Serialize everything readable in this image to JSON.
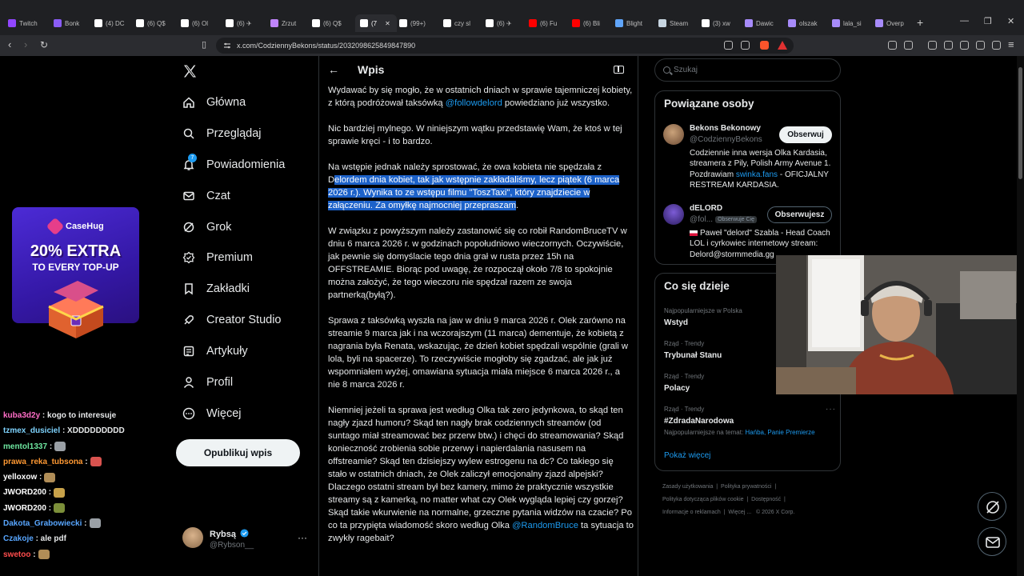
{
  "browser": {
    "tabs": [
      {
        "label": "Twitch",
        "color": "#9146ff",
        "icon": "twitch-icon"
      },
      {
        "label": "Bonk",
        "color": "#8a5cf6",
        "icon": "page-icon"
      },
      {
        "label": "(4) DC",
        "color": "#ffffff",
        "icon": "x-icon"
      },
      {
        "label": "(6) Q$",
        "color": "#ffffff",
        "icon": "x-icon"
      },
      {
        "label": "(6) Ol",
        "color": "#ffffff",
        "icon": "x-icon"
      },
      {
        "label": "(6) ✈",
        "color": "#ffffff",
        "icon": "x-icon"
      },
      {
        "label": "Zrzut",
        "color": "#c084fc",
        "icon": "pen-icon"
      },
      {
        "label": "(6) Q$",
        "color": "#ffffff",
        "icon": "x-icon"
      },
      {
        "label": "(7",
        "color": "#ffffff",
        "icon": "x-icon"
      },
      {
        "label": "(99+)",
        "color": "#ffffff",
        "icon": "tiktok-icon"
      },
      {
        "label": "czy sl",
        "color": "#ffffff",
        "icon": "google-icon"
      },
      {
        "label": "(6) ✈",
        "color": "#ffffff",
        "icon": "x-icon"
      },
      {
        "label": "(6) Fu",
        "color": "#ff0000",
        "icon": "youtube-icon"
      },
      {
        "label": "(6) Bli",
        "color": "#ff0000",
        "icon": "youtube-icon"
      },
      {
        "label": "Blight",
        "color": "#60a5fa",
        "icon": "page-icon"
      },
      {
        "label": "Steam",
        "color": "#c7d5e0",
        "icon": "steam-icon"
      },
      {
        "label": "(3) xw",
        "color": "#ffffff",
        "icon": "x-icon"
      },
      {
        "label": "Dawic",
        "color": "#a78bfa",
        "icon": "page-icon"
      },
      {
        "label": "olszak",
        "color": "#a78bfa",
        "icon": "page-icon"
      },
      {
        "label": "lala_si",
        "color": "#a78bfa",
        "icon": "page-icon"
      },
      {
        "label": "Overp",
        "color": "#a78bfa",
        "icon": "page-icon"
      }
    ],
    "url": "x.com/CodziennyBekons/status/2032098625849847890"
  },
  "ad": {
    "brand": "CaseHug",
    "line1": "20% EXTRA",
    "line2": "TO EVERY TOP-UP"
  },
  "chat": [
    {
      "user": "kuba3d2y",
      "user_color": "#ff6ec7",
      "msg": ": kogo to interesuje"
    },
    {
      "user": "tzmex_dusiciel",
      "user_color": "#7fd4ff",
      "msg": ": XDDDDDDDDD"
    },
    {
      "user": "mentol1337",
      "user_color": "#6ee7a0",
      "msg": ":"
    },
    {
      "user": "prawa_reka_tubsona",
      "user_color": "#ff9933",
      "msg": ":"
    },
    {
      "user": "yelloxow",
      "user_color": "#ffffff",
      "msg": ":"
    },
    {
      "user": "JWORD200",
      "user_color": "#ffffff",
      "msg": ":"
    },
    {
      "user": "JWORD200",
      "user_color": "#ffffff",
      "msg": ":"
    },
    {
      "user": "Dakota_Grabowiecki",
      "user_color": "#58a6ff",
      "msg": ":"
    },
    {
      "user": "Czakoje",
      "user_color": "#58a6ff",
      "msg": ": ale pdf"
    },
    {
      "user": "swetoo",
      "user_color": "#ff4d4d",
      "msg": ":"
    }
  ],
  "sidebar": {
    "items": [
      {
        "label": "Główna",
        "icon": "home-icon"
      },
      {
        "label": "Przeglądaj",
        "icon": "search-icon"
      },
      {
        "label": "Powiadomienia",
        "icon": "bell-icon",
        "badge": "7"
      },
      {
        "label": "Czat",
        "icon": "mail-icon"
      },
      {
        "label": "Grok",
        "icon": "grok-icon"
      },
      {
        "label": "Premium",
        "icon": "premium-icon"
      },
      {
        "label": "Zakładki",
        "icon": "bookmark-icon"
      },
      {
        "label": "Creator Studio",
        "icon": "rocket-icon"
      },
      {
        "label": "Artykuły",
        "icon": "article-icon"
      },
      {
        "label": "Profil",
        "icon": "user-icon"
      },
      {
        "label": "Więcej",
        "icon": "more-icon"
      }
    ],
    "post_button": "Opublikuj wpis",
    "profile": {
      "name": "Rybsą",
      "handle": "@Rybson__"
    }
  },
  "post": {
    "header_title": "Wpis",
    "p1_a": "Wydawać by się mogło, że w ostatnich dniach w sprawie tajemniczej kobiety, z którą podróżował taksówką ",
    "p1_mention": "@followdelord",
    "p1_b": " powiedziano już wszystko.",
    "p2": "Nic bardziej mylnego. W niniejszym wątku przedstawię Wam, że ktoś w tej sprawie kręci - i to bardzo.",
    "p3_a": "Na wstępie jednak należy sprostować, że owa kobieta nie spędzała z D",
    "p3_hl": "elordem dnia kobiet, tak jak wstępnie zakładaliśmy, lecz piątek (6 marca 2026 r.). Wynika to ze wstępu filmu \"ToszTaxi\", który znajdziecie w załączeniu. Za omyłkę najmocniej przepraszam",
    "p3_b": ".",
    "p4": "W związku z powyższym należy zastanowić się co robił RandomBruceTV w dniu 6 marca 2026 r. w godzinach popołudniowo wieczornych. Oczywiście, jak pewnie się domyślacie tego dnia grał w rusta przez 15h na OFFSTREAMIE. Biorąc pod uwagę, że rozpoczął około 7/8 to spokojnie można założyć, że tego wieczoru nie spędzał razem ze swoja partnerką(byłą?).",
    "p5": "Sprawa z taksówką wyszła na jaw w dniu 9 marca 2026 r. Olek zarówno na streamie 9 marca jak i na wczorajszym (11 marca) dementuje, że kobietą z nagrania była Renata, wskazując, że dzień kobiet spędzali wspólnie (grali w lola, byli na spacerze). To rzeczywiście mogłoby się zgadzać, ale jak już wspomniałem wyżej, omawiana sytuacja miała miejsce 6 marca 2026 r., a nie 8 marca 2026 r.",
    "p6_a": "Niemniej jeżeli ta sprawa jest według Olka tak zero jedynkowa, to skąd ten nagły zjazd humoru? Skąd ten nagły brak codziennych streamów (od suntago miał streamować bez przerw btw.) i chęci do streamowania? Skąd konieczność zrobienia sobie przerwy i napierdalania nasusem na offstreamie? Skąd ten dzisiejszy wylew estrogenu na dc? Co takiego się stało w ostatnich dniach, że Olek zaliczył emocjonalny zjazd alpejski? Dlaczego ostatni stream był bez kamery, mimo że praktycznie wszystkie streamy są z kamerką, no matter what czy Olek wygląda lepiej czy gorzej? Skąd takie wkurwienie na normalne, grzeczne pytania widzów na czacie? Po co ta przypięta wiadomość skoro według Olka ",
    "p6_mention": "@RandomBruce",
    "p6_b": " ta sytuacja to zwykły ragebait?"
  },
  "search": {
    "placeholder": "Szukaj"
  },
  "related": {
    "title": "Powiązane osoby",
    "people": [
      {
        "name": "Bekons Bekonowy",
        "handle": "@CodziennyBekons",
        "button": "Obserwuj",
        "bio_a": "Codziennie inna wersja Olka Kardasia, streamera z Pily, Polish Army Avenue 1. Pozdrawiam ",
        "bio_link": "swinka.fans",
        "bio_b": " - OFICJALNY RESTREAM KARDASIA."
      },
      {
        "name": "dELORD",
        "handle": "@fol...",
        "follows_you": "Obserwuje Cię",
        "button": "Obserwujesz",
        "bio": "Paweł \"delord\" Szabla - Head Coach LOL i cyrkowiec internetowy stream: Delord@stormmedia.gg"
      }
    ]
  },
  "trends": {
    "title": "Co się dzieje",
    "items": [
      {
        "context": "Najpopularniejsze w Polska",
        "name": "Wstyd"
      },
      {
        "context": "Rząd · Trendy",
        "name": "Trybunał Stanu"
      },
      {
        "context": "Rząd · Trendy",
        "name": "Polacy"
      },
      {
        "context": "Rząd · Trendy",
        "name": "#ZdradaNarodowa",
        "sub_a": "Najpopularniejsze na temat: ",
        "sub_link": "Hańba, Panie Premierze"
      }
    ],
    "show_more": "Pokaż więcej"
  },
  "footer": {
    "links": [
      "Zasady użytkowania",
      "Polityka prywatności",
      "Polityka dotycząca plików cookie",
      "Dostępność",
      "Informacje o reklamach",
      "Więcej ...",
      "© 2026 X Corp."
    ]
  }
}
